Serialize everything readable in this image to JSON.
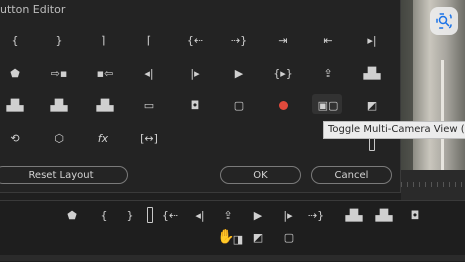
{
  "editor": {
    "title": "utton Editor",
    "buttons": {
      "reset": "Reset Layout",
      "ok": "OK",
      "cancel": "Cancel"
    }
  },
  "tooltip": "Toggle Multi-Camera View (Sh",
  "fx_label": "fx",
  "icons_row1": [
    "mark-in-brace",
    "mark-out-brace",
    "mark-clip-bracket",
    "go-to-in-bracket",
    "step-to-in",
    "step-to-out",
    "go-to-out",
    "go-to-previous-edit",
    "go-to-next-edit"
  ],
  "icons_row2": [
    "add-marker",
    "lift",
    "extract-left",
    "step-back",
    "step-forward",
    "play",
    "play-in-to-out",
    "export-frame",
    "insert-sequence"
  ],
  "icons_row3": [
    "camera-stack",
    "overwrite",
    "replace",
    "safe-margins",
    "camera",
    "comment",
    "record",
    "multi-camera",
    "toggle-proxies"
  ],
  "icons_row4": [
    "loop",
    "vr-video",
    "fx",
    "fit"
  ],
  "colors": {
    "record": "#e14a3c",
    "background": "#1f1f1f",
    "panel": "#232323",
    "tooltip_bg": "#ececec"
  }
}
